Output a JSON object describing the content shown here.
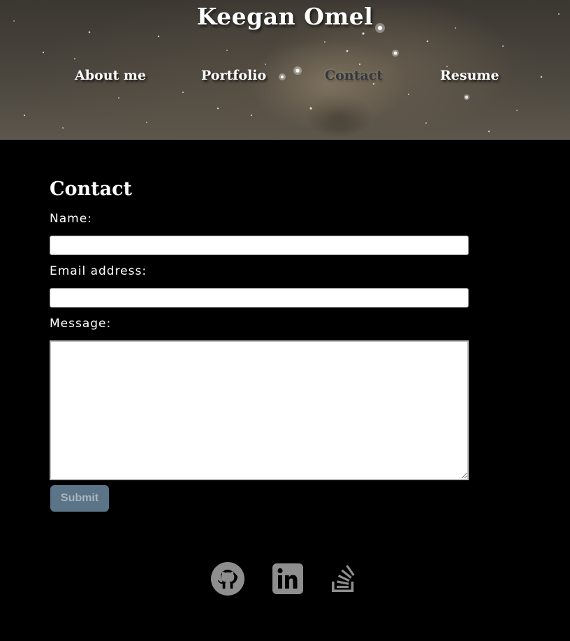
{
  "header": {
    "title": "Keegan Omel",
    "nav": [
      {
        "label": "About me"
      },
      {
        "label": "Portfolio"
      },
      {
        "label": "Contact"
      },
      {
        "label": "Resume"
      }
    ]
  },
  "contact": {
    "heading": "Contact",
    "name_label": "Name:",
    "name_value": "",
    "email_label": "Email address:",
    "email_value": "",
    "message_label": "Message:",
    "message_value": "",
    "submit_label": "Submit"
  },
  "footer": {
    "icons": [
      "github-icon",
      "linkedin-icon",
      "stack-overflow-icon"
    ],
    "icon_color": "#8e8e8e"
  },
  "colors": {
    "background": "#000000",
    "nav_active": "#34373c",
    "submit_bg": "#5b7487",
    "submit_text": "#a9b6c0"
  }
}
